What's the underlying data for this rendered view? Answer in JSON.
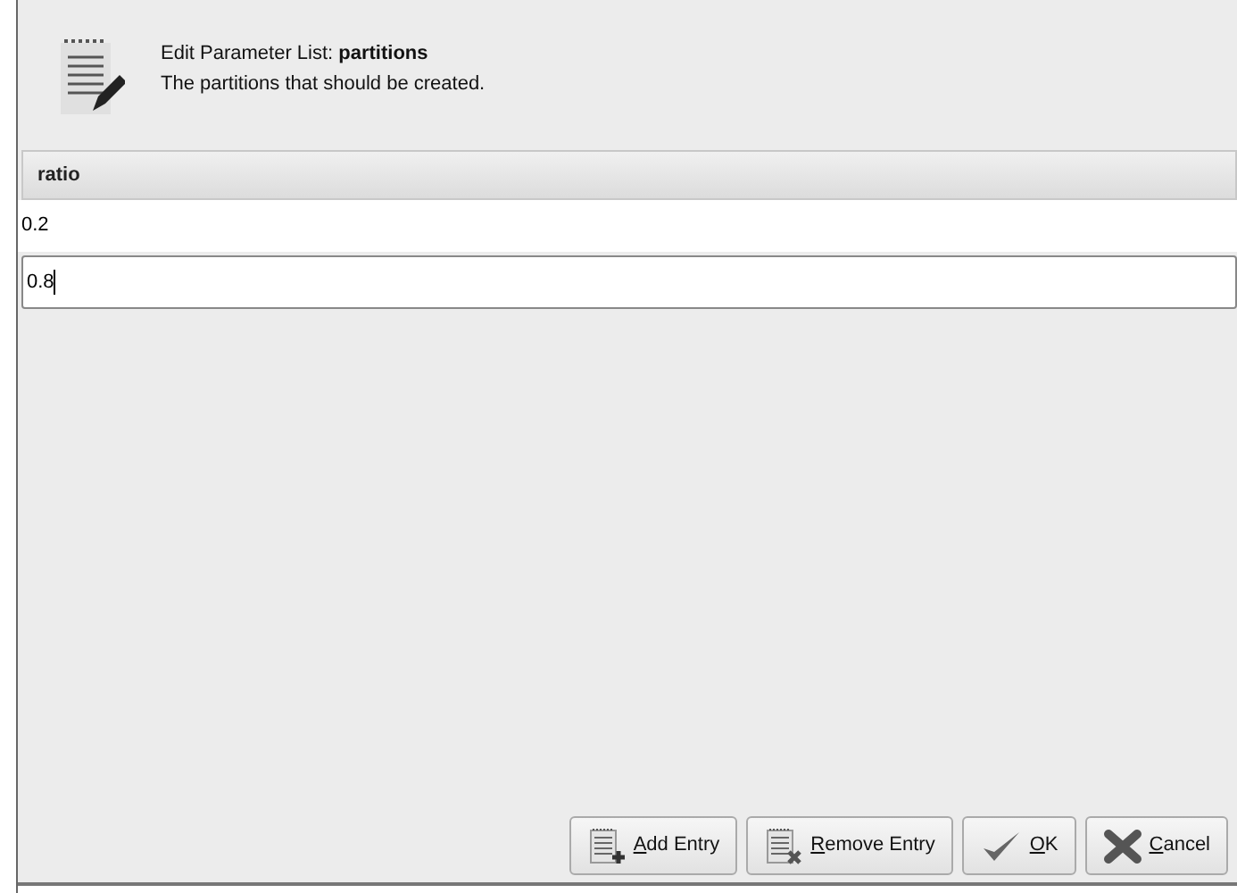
{
  "header": {
    "title_prefix": "Edit Parameter List: ",
    "title_name": "partitions",
    "description": "The partitions that should be created."
  },
  "table": {
    "columns": [
      "ratio"
    ],
    "rows": [
      {
        "value": "0.2",
        "editing": false
      },
      {
        "value": "0.8",
        "editing": true
      }
    ]
  },
  "buttons": [
    {
      "label": "Add Entry",
      "kind": "add"
    },
    {
      "label": "Remove Entry",
      "kind": "remove"
    },
    {
      "label": "OK",
      "kind": "ok"
    },
    {
      "label": "Cancel",
      "kind": "cancel"
    }
  ]
}
